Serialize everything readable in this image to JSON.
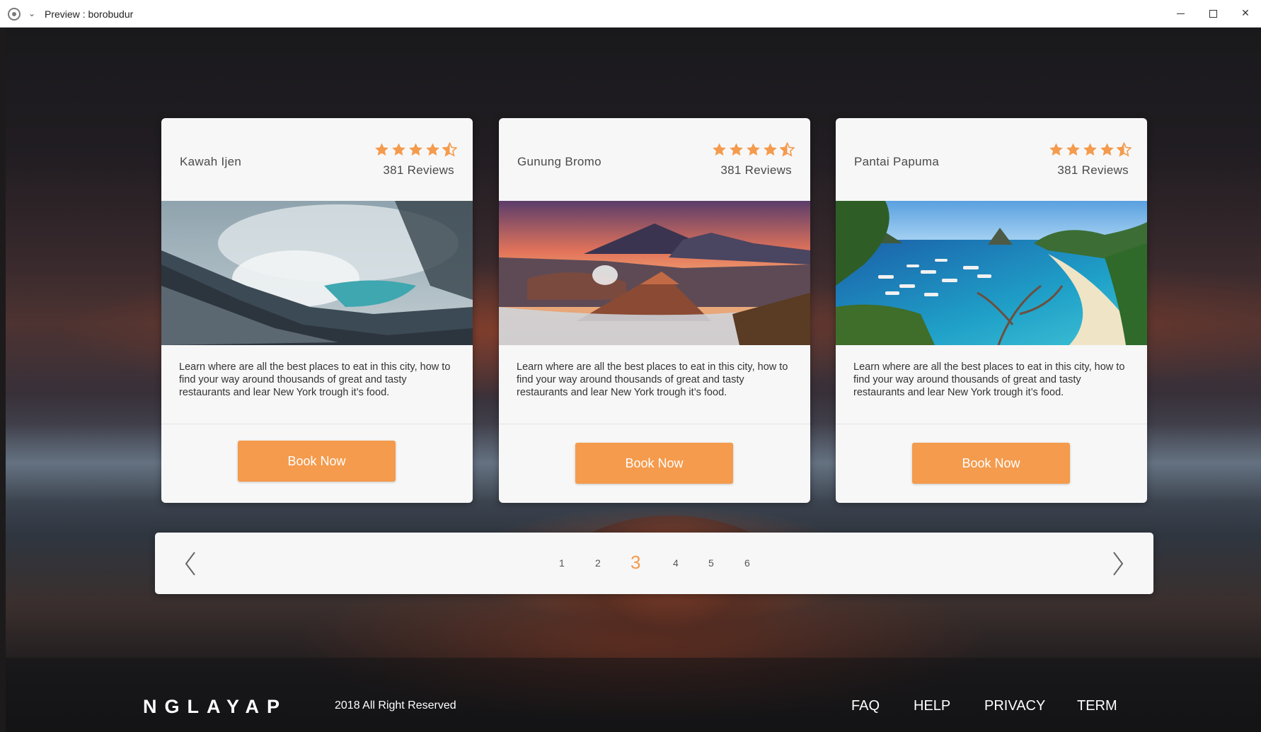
{
  "window": {
    "title": "Preview : borobudur"
  },
  "cards": [
    {
      "title": "Kawah Ijen",
      "rating": 4.5,
      "reviews": "381 Reviews",
      "image": "crater-lake-photo",
      "description": "Learn where are all the best places to eat in this city, how to find your way around thousands of great and tasty restaurants and lear New York trough it’s food.",
      "button": "Book Now"
    },
    {
      "title": "Gunung Bromo",
      "rating": 4.5,
      "reviews": "381 Reviews",
      "image": "volcano-sunrise-photo",
      "description": "Learn where are all the best places to eat in this city, how to find your way around thousands of great and tasty restaurants and lear New York trough it’s food.",
      "button": "Book Now"
    },
    {
      "title": "Pantai Papuma",
      "rating": 4.5,
      "reviews": "381 Reviews",
      "image": "beach-boats-photo",
      "description": "Learn where are all the best places to eat in this city, how to find your way around thousands of great and tasty restaurants and lear New York trough it’s food.",
      "button": "Book Now"
    }
  ],
  "pagination": {
    "pages": [
      "1",
      "2",
      "3",
      "4",
      "5",
      "6"
    ],
    "current": "3",
    "prev_icon": "chevron-left-icon",
    "next_icon": "chevron-right-icon"
  },
  "footer": {
    "logo": "NGLAYAP",
    "copyright": "2018 All Right Reserved",
    "links": [
      "FAQ",
      "HELP",
      "PRIVACY",
      "TERM"
    ]
  },
  "colors": {
    "accent": "#f49b4d",
    "card_bg": "#f7f7f7",
    "text": "#4a4a4a"
  }
}
